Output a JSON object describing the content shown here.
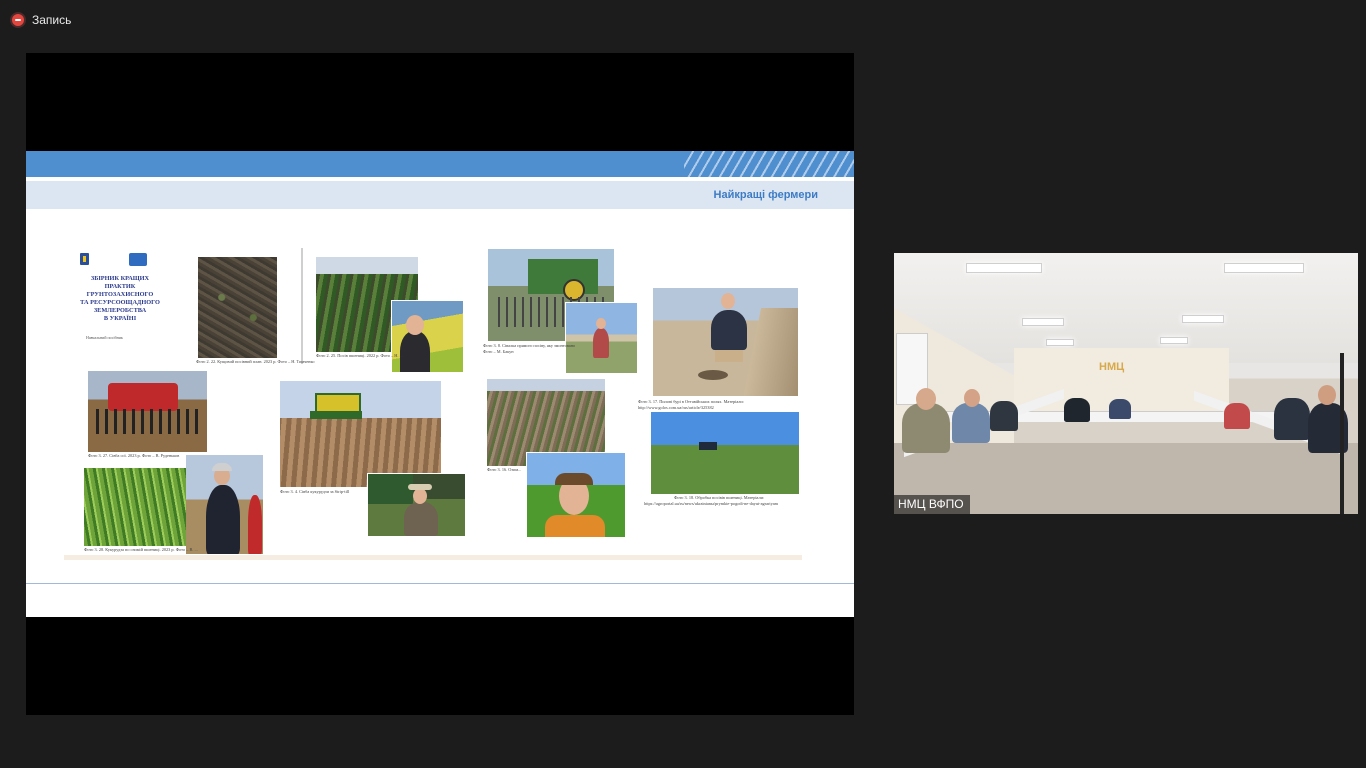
{
  "recording": {
    "label": "Запись",
    "indicator_color": "#e2463f"
  },
  "slide": {
    "title": "Найкращі фермери",
    "accent_color": "#4f8fd0",
    "cover": {
      "title_lines": [
        "ЗБІРНИК КРАЩИХ",
        "ПРАКТИК",
        "ГРУНТОЗАХИСНОГО",
        "ТА РЕСУРСООЩАДНОГО",
        "ЗЕМЛЕРОБСТВА",
        "В УКРАЇНІ"
      ],
      "note": "Навчальний посібник"
    },
    "captions": {
      "c1": "Фото 2. 22. Кущовий посівний план. 2023 р. Фото – Н. Тимченко",
      "c2": "Фото 2. 25. Посів пшениці. 2022 р. Фото – Н. ...",
      "c3a": "Фото 3. 8. Сівалка прямого посіву, яку змонтовано",
      "c3b": "Фото – М. Бакун",
      "c4a": "Фото 3. 17. Пилові бурі в Оттавійських полях. Матеріали:",
      "c4b": "http://www.golos.com.ua/rus/article/325382",
      "c5": "Фото 3. 27. Сівба сої. 2023 р. Фото – В. Руденьков",
      "c6": "Фото 3. 4. Сівба кукурудзи за Strip-till",
      "c7": "Фото 3. 16. Озим...",
      "c8a": "Фото 3. 18. Обробка посівів пшениці. Матеріали:",
      "c8b": "https://agroportal.ua/ru/news/ukrainianы/prymkie-pogodi-ne-dayut-agrariyam",
      "c9": "Фото 3. 28. Кукурудза по озимій пшениці. 2023 р. Фото – В. ..."
    }
  },
  "camera": {
    "participant_label": "НМЦ ВФПО",
    "wall_logo": "НМЦ"
  }
}
